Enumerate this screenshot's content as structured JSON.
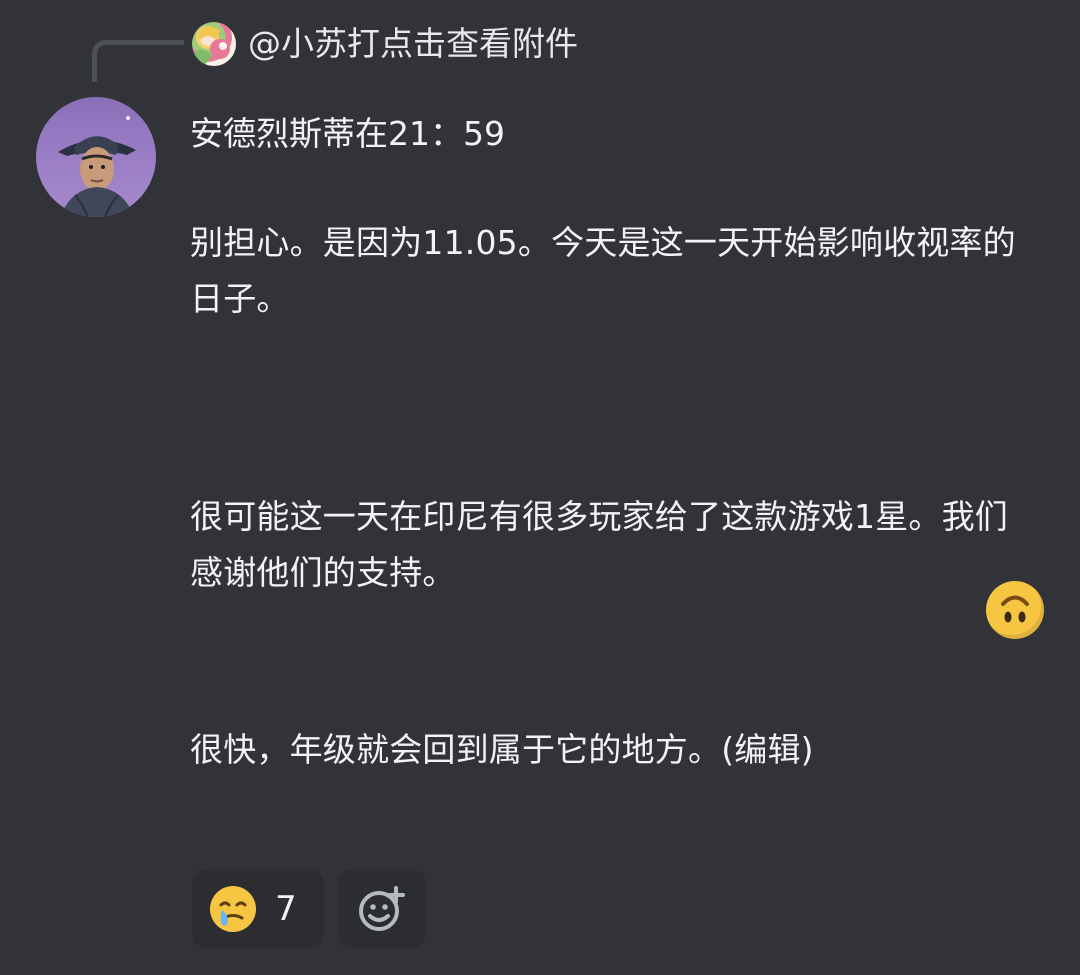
{
  "reply": {
    "username": "@小苏打",
    "preview": "点击查看附件"
  },
  "message": {
    "header": "安德烈斯蒂在21：59",
    "paragraphs": [
      "别担心。是因为11.05。今天是这一天开始影响收视率的日子。",
      "很可能这一天在印尼有很多玩家给了这款游戏1星。我们感谢他们的支持。",
      "很快，年级就会回到属于它的地方。(编辑)"
    ]
  },
  "reactions": [
    {
      "emoji": "crying-face-icon",
      "count": "7"
    }
  ],
  "add_reaction": {
    "icon": "add-reaction-icon"
  },
  "floating_emoji": {
    "icon": "upside-down-face-icon"
  },
  "colors": {
    "background": "#313338",
    "text": "#f2f3f5",
    "reaction_bg": "#2b2d31",
    "reply_line": "#4e5058",
    "emoji_yellow": "#f6c643"
  }
}
